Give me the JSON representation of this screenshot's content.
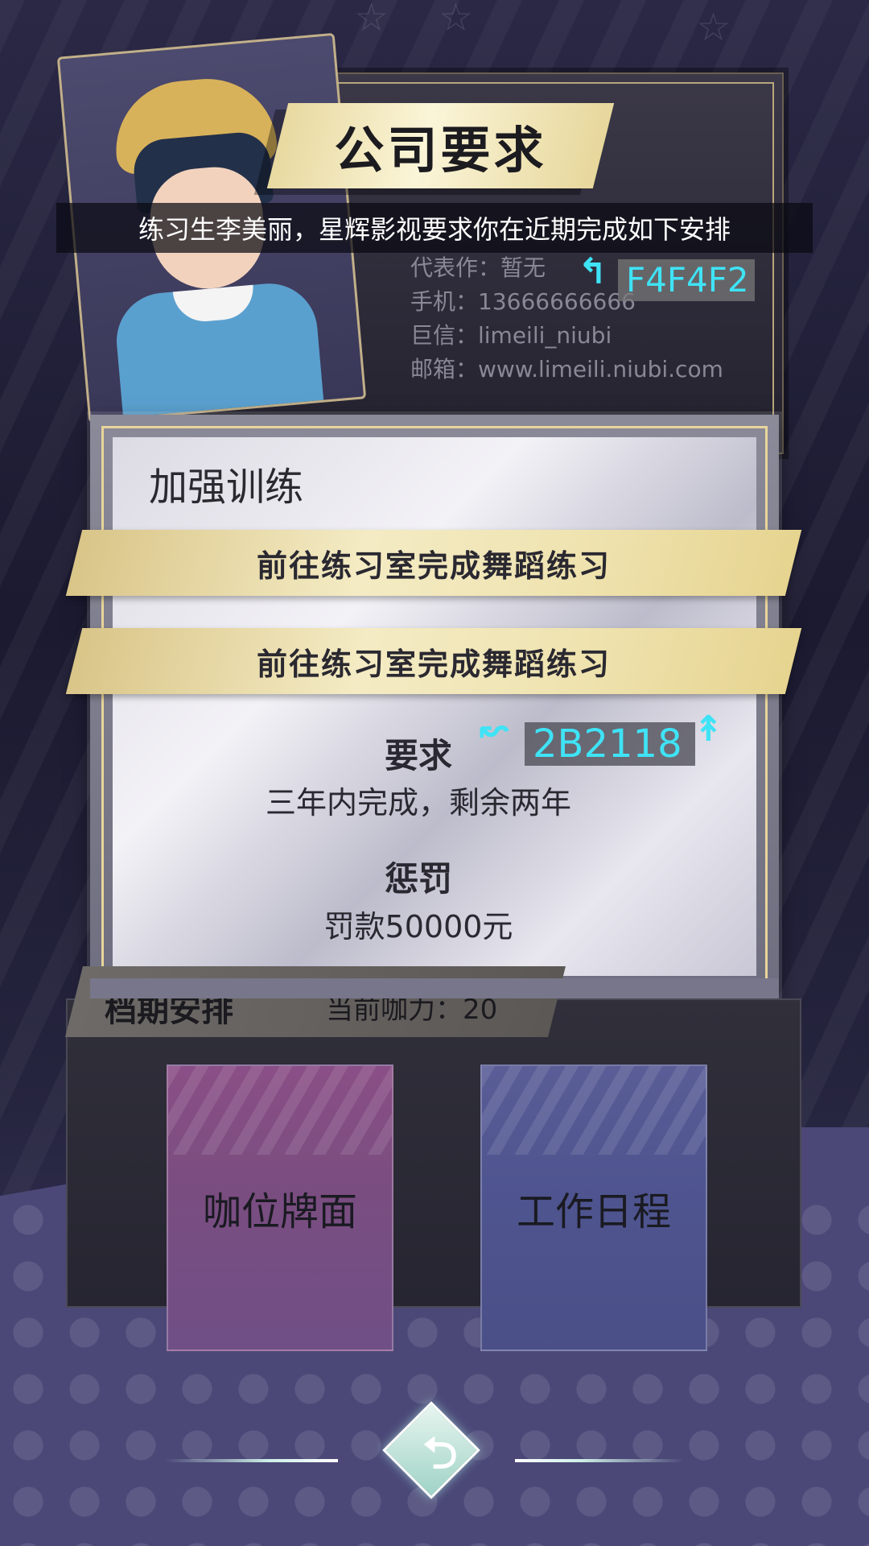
{
  "dialog": {
    "title": "公司要求",
    "notice": "练习生李美丽，星辉影视要求你在近期完成如下安排"
  },
  "profile": {
    "lines": [
      "代表作：暂无",
      "手机：13666666666",
      "巨信：limeili_niubi",
      "邮箱：www.limeili.niubi.com"
    ]
  },
  "annotations": {
    "color_a": "F4F4F2",
    "color_b": "2B2118"
  },
  "training": {
    "section_title": "加强训练",
    "tasks": [
      "前往练习室完成舞蹈练习",
      "前往练习室完成舞蹈练习"
    ],
    "requirement_label": "要求",
    "requirement_value": "三年内完成，剩余两年",
    "penalty_label": "惩罚",
    "penalty_value": "罚款50000元"
  },
  "schedule": {
    "title": "档期安排",
    "info": "当前咖力：20"
  },
  "choices": {
    "left": "咖位牌面",
    "right": "工作日程"
  },
  "icons": {
    "back": "return-arrow-icon"
  },
  "colors": {
    "accent_gold": "#E8D59A",
    "annotation_cyan": "#3FE3F6",
    "text_dark": "#2B2118",
    "paper_light": "#F4F4F2"
  }
}
